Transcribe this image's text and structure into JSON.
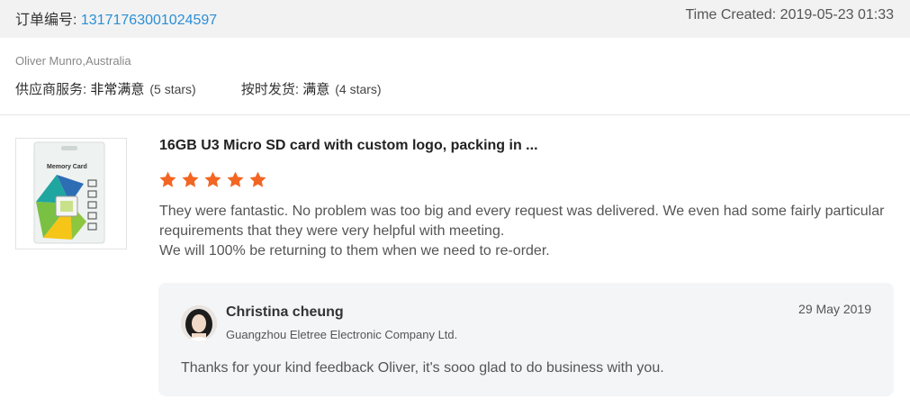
{
  "order": {
    "label": "订单编号: ",
    "number": "13171763001024597",
    "time_created": "Time Created: 2019-05-23 01:33"
  },
  "buyer": {
    "name_country": "Oliver Munro,Australia"
  },
  "ratings": [
    {
      "label": "供应商服务: ",
      "value": "非常满意",
      "stars_text": "(5 stars)"
    },
    {
      "label": "按时发货: ",
      "value": "满意",
      "stars_text": "(4 stars)"
    }
  ],
  "product": {
    "title": "16GB U3 Micro SD card with custom logo, packing in ...",
    "thumb_text": "Memory Card",
    "rating": 5,
    "star_color": "#f26522"
  },
  "review": {
    "paragraphs": [
      "They were fantastic. No problem was too big and every request was delivered. We even had some fairly particular requirements that they were very helpful with meeting.",
      "We will 100% be returning to them when we need to re-order."
    ]
  },
  "reply": {
    "name": "Christina cheung",
    "company": "Guangzhou Eletree Electronic Company Ltd.",
    "date": "29 May 2019",
    "text": "Thanks for your kind feedback Oliver, it's sooo glad to do business with you."
  },
  "colors": {
    "link": "#2b8fd6",
    "header_bg": "#f2f2f2",
    "reply_bg": "#f4f5f7"
  }
}
